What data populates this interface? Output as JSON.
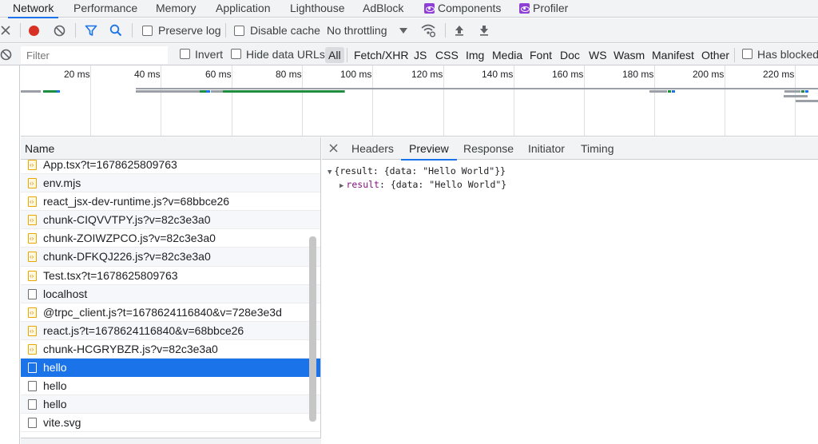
{
  "tabs": [
    {
      "label": "Network",
      "icon": null
    },
    {
      "label": "Performance",
      "icon": null
    },
    {
      "label": "Memory",
      "icon": null
    },
    {
      "label": "Application",
      "icon": null
    },
    {
      "label": "Lighthouse",
      "icon": null
    },
    {
      "label": "AdBlock",
      "icon": null
    },
    {
      "label": "Components",
      "icon": "react-icon"
    },
    {
      "label": "Profiler",
      "icon": "react-icon"
    }
  ],
  "toolbar": {
    "preserve_log": "Preserve log",
    "disable_cache": "Disable cache",
    "throttling": "No throttling",
    "record_color": "#d93025",
    "accent": "#1a73e8"
  },
  "filterbar": {
    "placeholder": "Filter",
    "invert": "Invert",
    "hide_data_urls": "Hide data URLs",
    "types": [
      "All",
      "Fetch/XHR",
      "JS",
      "CSS",
      "Img",
      "Media",
      "Font",
      "Doc",
      "WS",
      "Wasm",
      "Manifest",
      "Other"
    ],
    "selected_type": "All",
    "has_blocked": "Has blocked"
  },
  "overview": {
    "ticks": [
      "20 ms",
      "40 ms",
      "60 ms",
      "80 ms",
      "100 ms",
      "120 ms",
      "140 ms",
      "160 ms",
      "180 ms",
      "200 ms",
      "220 ms"
    ]
  },
  "requests": {
    "header": "Name",
    "rows": [
      {
        "name": "App.tsx?t=1678625809763",
        "type": "js",
        "selected": false
      },
      {
        "name": "env.mjs",
        "type": "js",
        "selected": false
      },
      {
        "name": "react_jsx-dev-runtime.js?v=68bbce26",
        "type": "js",
        "selected": false
      },
      {
        "name": "chunk-CIQVVTPY.js?v=82c3e3a0",
        "type": "js",
        "selected": false
      },
      {
        "name": "chunk-ZOIWZPCO.js?v=82c3e3a0",
        "type": "js",
        "selected": false
      },
      {
        "name": "chunk-DFKQJ226.js?v=82c3e3a0",
        "type": "js",
        "selected": false
      },
      {
        "name": "Test.tsx?t=1678625809763",
        "type": "js",
        "selected": false
      },
      {
        "name": "localhost",
        "type": "doc",
        "selected": false
      },
      {
        "name": "@trpc_client.js?t=1678624116840&v=728e3e3d",
        "type": "js",
        "selected": false
      },
      {
        "name": "react.js?t=1678624116840&v=68bbce26",
        "type": "js",
        "selected": false
      },
      {
        "name": "chunk-HCGRYBZR.js?v=82c3e3a0",
        "type": "js",
        "selected": false
      },
      {
        "name": "hello",
        "type": "doc",
        "selected": true
      },
      {
        "name": "hello",
        "type": "doc",
        "selected": false
      },
      {
        "name": "hello",
        "type": "doc",
        "selected": false
      },
      {
        "name": "vite.svg",
        "type": "doc",
        "selected": false
      }
    ]
  },
  "detail": {
    "tabs": [
      "Headers",
      "Preview",
      "Response",
      "Initiator",
      "Timing"
    ],
    "active_tab": "Preview",
    "preview_line1": "{result: {data: \"Hello World\"}}",
    "preview_key": "result",
    "preview_value": ": {data: \"Hello World\"}"
  }
}
